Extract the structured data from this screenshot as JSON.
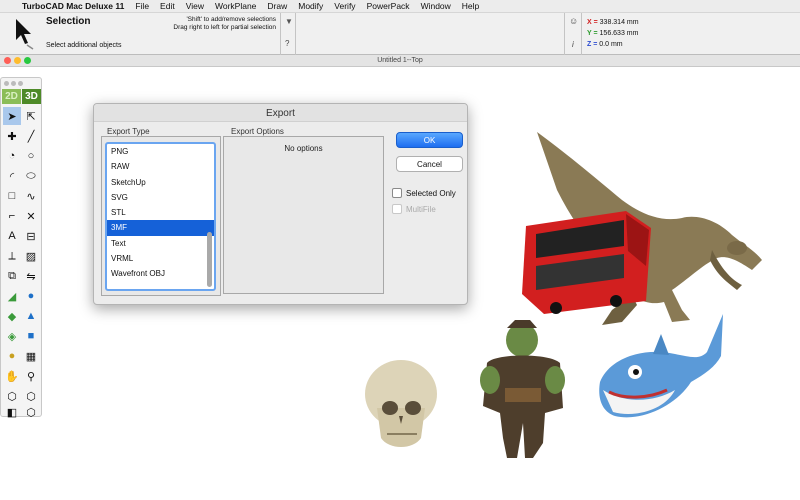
{
  "menubar": {
    "app_name": "TurboCAD Mac Deluxe 11",
    "items": [
      "File",
      "Edit",
      "View",
      "WorkPlane",
      "Draw",
      "Modify",
      "Verify",
      "PowerPack",
      "Window",
      "Help"
    ]
  },
  "toolbar": {
    "tool_name": "Selection",
    "tool_subtitle": "Select additional objects",
    "hint_line1": "'Shift' to add/remove selections",
    "hint_line2": "Drag right to left for partial selection"
  },
  "coords": {
    "x_label": "X =",
    "x_value": "338.314 mm",
    "y_label": "Y =",
    "y_value": "156.633 mm",
    "z_label": "Z =",
    "z_value": "0.0 mm"
  },
  "window": {
    "title": "Untitled 1--Top"
  },
  "palette": {
    "btn_2d": "2D",
    "btn_3d": "3D"
  },
  "dialog": {
    "title": "Export",
    "export_type_label": "Export Type",
    "export_options_label": "Export Options",
    "no_options": "No options",
    "types": [
      "PNG",
      "RAW",
      "SketchUp",
      "SVG",
      "STL",
      "3MF",
      "Text",
      "VRML",
      "Wavefront OBJ"
    ],
    "selected_type": "3MF",
    "ok": "OK",
    "cancel": "Cancel",
    "selected_only": "Selected Only",
    "multifile": "MultiFile"
  },
  "colors": {
    "accent": "#1561d8",
    "ok_button": "#2a7cf5",
    "close": "#fe5f57",
    "minimize": "#febc2e",
    "zoom": "#28c840"
  }
}
